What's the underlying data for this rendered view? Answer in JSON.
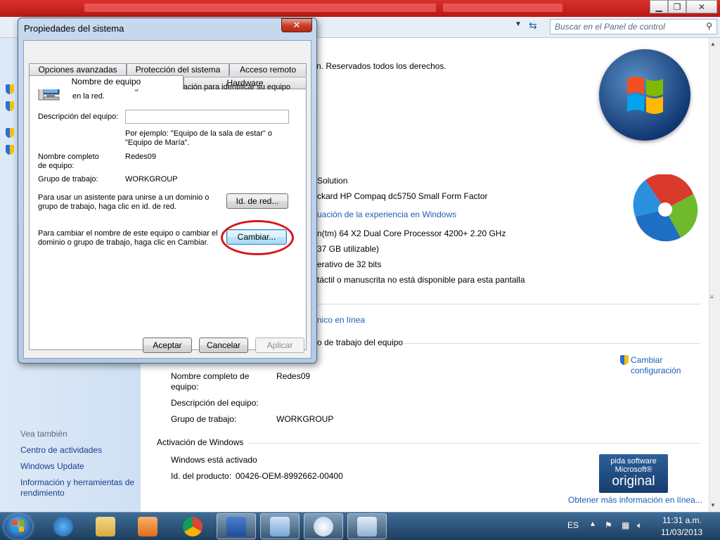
{
  "control_panel": {
    "search_placeholder": "Buscar en el Panel de control",
    "copyright": "n. Reservados todos los derechos.",
    "system_lines": [
      "Solution",
      "ckard HP Compaq dc5750 Small Form Factor",
      "uación de la experiencia en Windows",
      "n(tm) 64 X2 Dual Core Processor 4200+   2.20 GHz",
      "37 GB utilizable)",
      "erativo de 32 bits",
      "táctil o manuscrita no está disponible para esta pantalla"
    ],
    "support_link": "nico en línea",
    "computer_section_header": "o de trabajo del equipo",
    "change_config_link_1": "Cambiar",
    "change_config_link_2": "configuración",
    "full_name_label_1": "Nombre completo de",
    "full_name_label_2": "equipo:",
    "full_name_value": "Redes09",
    "description_label": "Descripción del equipo:",
    "workgroup_label": "Grupo de trabajo:",
    "workgroup_value": "WORKGROUP",
    "activation_header": "Activación de Windows",
    "activation_status": "Windows está activado",
    "product_id_label": "Id. del producto:",
    "product_id_value": "00426-OEM-8992662-00400",
    "more_info_link": "Obtener más información en línea...",
    "genuine_line1": "pida software",
    "genuine_line2": "Microsoft®",
    "genuine_line3": "original",
    "see_also_label": "Vea también",
    "see_also_links": [
      "Centro de actividades",
      "Windows Update",
      "Información y herramientas de",
      "rendimiento"
    ]
  },
  "dialog": {
    "title": "Propiedades del sistema",
    "close_glyph": "✕",
    "tabs_back": [
      "Opciones avanzadas",
      "Protección del sistema",
      "Acceso remoto"
    ],
    "tabs_front": [
      "Nombre de equipo",
      "Hardware"
    ],
    "intro_line1": "Windows usa la siguiente información para identificar su equipo",
    "intro_line2": "en la red.",
    "description_label": "Descripción del equipo:",
    "description_value": "",
    "example_line1": "Por ejemplo: \"Equipo de la sala de estar\" o",
    "example_line2": "\"Equipo de María\".",
    "full_name_label_1": "Nombre completo",
    "full_name_label_2": "de equipo:",
    "full_name_value": "Redes09",
    "workgroup_label": "Grupo de trabajo:",
    "workgroup_value": "WORKGROUP",
    "join_text_1": "Para usar un asistente para unirse a un dominio o",
    "join_text_2": "grupo de trabajo, haga clic en id. de red.",
    "network_id_button": "Id. de red...",
    "change_text_1": "Para cambiar el nombre de este equipo o cambiar el",
    "change_text_2": "dominio o grupo de trabajo, haga clic en Cambiar.",
    "change_button": "Cambiar...",
    "ok_button": "Aceptar",
    "cancel_button": "Cancelar",
    "apply_button": "Aplicar"
  },
  "taskbar": {
    "language": "ES",
    "time": "11:31 a.m.",
    "date": "11/03/2013"
  },
  "colors": {
    "highlight_circle": "#d8161c",
    "link": "#1a5eb8",
    "taskbar": "#1d3e5e"
  }
}
